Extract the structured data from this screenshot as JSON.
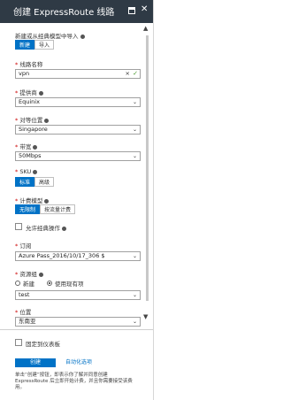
{
  "titlebar": {
    "title": "创建 ExpressRoute 线路",
    "minimize_icon": "minimize-icon",
    "close_icon": "close-icon",
    "close_glyph": "✕"
  },
  "form": {
    "create_mode": {
      "label": "新建或从经典模型中导入",
      "options": [
        "新建",
        "导入"
      ],
      "selected": "新建"
    },
    "circuit_name": {
      "label": "线路名称",
      "value": "vpn",
      "clear_glyph": "×",
      "valid_glyph": "✓"
    },
    "provider": {
      "label": "提供商",
      "value": "Equinix"
    },
    "peering_location": {
      "label": "对等位置",
      "value": "Singapore"
    },
    "bandwidth": {
      "label": "带宽",
      "value": "50Mbps"
    },
    "sku": {
      "label": "SKU",
      "options": [
        "标准",
        "高级"
      ],
      "selected": "标准"
    },
    "billing_model": {
      "label": "计费模型",
      "options": [
        "无限制",
        "按流量计费"
      ],
      "selected": "无限制"
    },
    "allow_classic": {
      "label": "允许经典操作",
      "checked": false
    },
    "subscription": {
      "label": "订阅",
      "value": "Azure Pass_2016/10/17_306 $"
    },
    "resource_group": {
      "label": "资源组",
      "options": [
        "新建",
        "使用现有项"
      ],
      "selected": "使用现有项",
      "value": "test"
    },
    "location": {
      "label": "位置",
      "value": "东南亚"
    }
  },
  "footer": {
    "pin_label": "固定到仪表板",
    "create_button": "创建",
    "automation_link": "自动化选项",
    "note": "单击“创建”按钮，即表示你了解并同意创建 ExpressRoute 后立即开始计费，并且你需要接受该费用。"
  },
  "glyphs": {
    "chevron": "⌄",
    "scroll_up": "▲",
    "scroll_down": "▼"
  },
  "colors": {
    "titlebar": "#2f3a45",
    "accent": "#0072c6",
    "valid": "#4a9b2f"
  }
}
